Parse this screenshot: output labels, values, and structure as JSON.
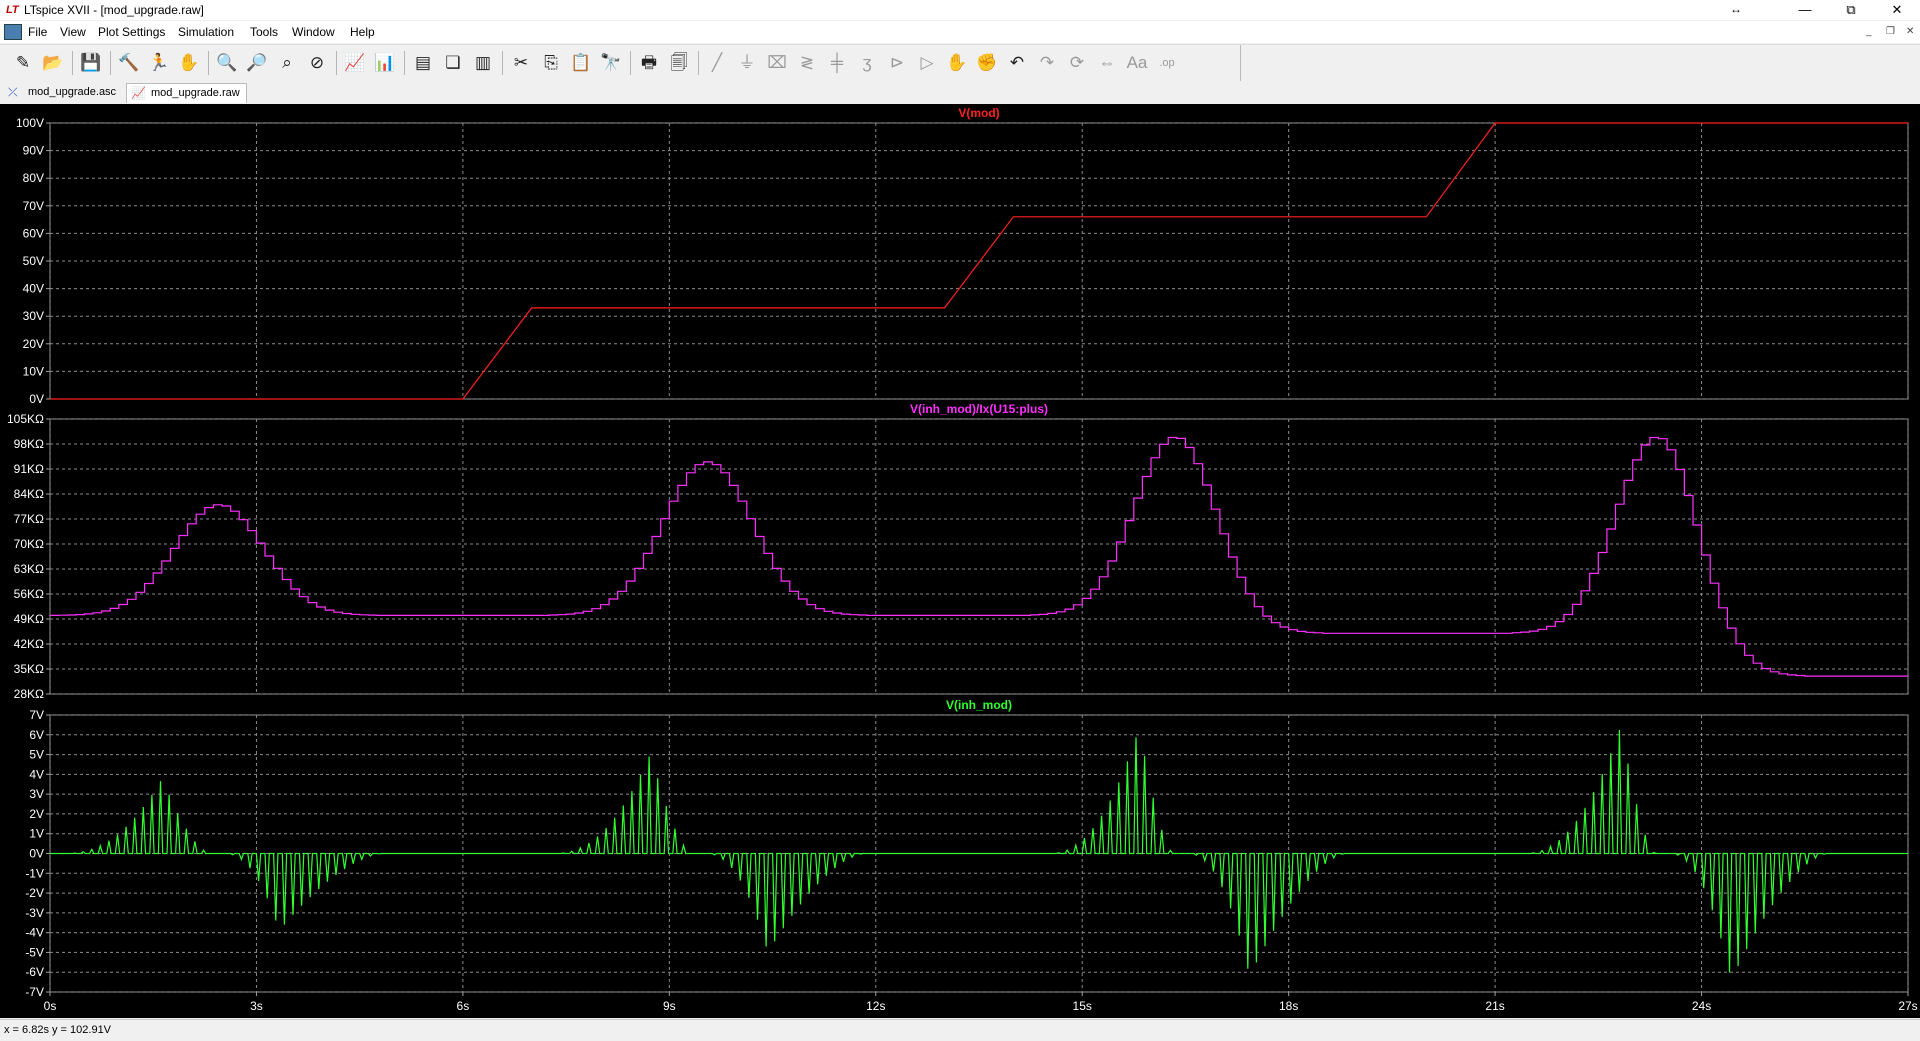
{
  "window": {
    "title": "LTspice XVII - [mod_upgrade.raw]",
    "app_icon_glyph": "LT",
    "minimize": "—",
    "restore": "⧉",
    "close": "✕",
    "resize_glyph": "↔"
  },
  "menu": [
    "File",
    "View",
    "Plot Settings",
    "Simulation",
    "Tools",
    "Window",
    "Help"
  ],
  "mdi": {
    "minimize": "_",
    "restore": "❐",
    "close": "✕"
  },
  "toolbar": [
    {
      "name": "new-schematic-icon",
      "glyph": "✎",
      "disabled": false
    },
    {
      "name": "open-icon",
      "glyph": "📂",
      "disabled": false
    },
    {
      "sep": true
    },
    {
      "name": "save-icon",
      "glyph": "💾",
      "disabled": false
    },
    {
      "sep": true
    },
    {
      "name": "control-panel-icon",
      "glyph": "🔨",
      "disabled": false
    },
    {
      "name": "run-icon",
      "glyph": "🏃",
      "disabled": false
    },
    {
      "name": "pan-hand-icon",
      "glyph": "✋",
      "disabled": false
    },
    {
      "sep": true
    },
    {
      "name": "zoom-in-icon",
      "glyph": "🔍",
      "disabled": false
    },
    {
      "name": "zoom-out-icon",
      "glyph": "🔎",
      "disabled": false
    },
    {
      "name": "zoom-fit-icon",
      "glyph": "⌕",
      "disabled": false
    },
    {
      "name": "zoom-cancel-icon",
      "glyph": "⊘",
      "disabled": false
    },
    {
      "sep": true
    },
    {
      "name": "autorange-icon",
      "glyph": "📈",
      "disabled": false
    },
    {
      "name": "fft-icon",
      "glyph": "📊",
      "disabled": false
    },
    {
      "sep": true
    },
    {
      "name": "tile-horizontal-icon",
      "glyph": "▤",
      "disabled": false
    },
    {
      "name": "cascade-icon",
      "glyph": "❏",
      "disabled": false
    },
    {
      "name": "tile-vertical-icon",
      "glyph": "▥",
      "disabled": false
    },
    {
      "sep": true
    },
    {
      "name": "cut-icon",
      "glyph": "✂",
      "disabled": false
    },
    {
      "name": "copy-icon",
      "glyph": "⎘",
      "disabled": false
    },
    {
      "name": "paste-icon",
      "glyph": "📋",
      "disabled": false
    },
    {
      "name": "find-icon",
      "glyph": "🔭",
      "disabled": false
    },
    {
      "sep": true
    },
    {
      "name": "print-icon",
      "glyph": "🖶",
      "disabled": false
    },
    {
      "name": "print-preview-icon",
      "glyph": "🗐",
      "disabled": false
    },
    {
      "sep": true
    },
    {
      "name": "wire-icon",
      "glyph": "╱",
      "disabled": true
    },
    {
      "name": "ground-icon",
      "glyph": "⏚",
      "disabled": true
    },
    {
      "name": "label-net-icon",
      "glyph": "⌧",
      "disabled": true
    },
    {
      "name": "resistor-icon",
      "glyph": "≷",
      "disabled": true
    },
    {
      "name": "capacitor-icon",
      "glyph": "╪",
      "disabled": true
    },
    {
      "name": "inductor-icon",
      "glyph": "ʒ",
      "disabled": true
    },
    {
      "name": "diode-icon",
      "glyph": "⊳",
      "disabled": true
    },
    {
      "name": "component-icon",
      "glyph": "▷",
      "disabled": true
    },
    {
      "name": "move-icon",
      "glyph": "✋",
      "disabled": true
    },
    {
      "name": "drag-icon",
      "glyph": "✊",
      "disabled": true
    },
    {
      "name": "undo-icon",
      "glyph": "↶",
      "disabled": false
    },
    {
      "name": "redo-icon",
      "glyph": "↷",
      "disabled": true
    },
    {
      "name": "rotate-icon",
      "glyph": "⟳",
      "disabled": true
    },
    {
      "name": "mirror-icon",
      "glyph": "⇔",
      "disabled": true
    },
    {
      "name": "text-icon",
      "glyph": "Aa",
      "disabled": true
    },
    {
      "name": "spice-directive-icon",
      "glyph": ".op",
      "disabled": true
    }
  ],
  "tabs": [
    {
      "label": "mod_upgrade.asc",
      "icon_glyph": "⤫",
      "icon_color": "#1f4fbf",
      "active": false
    },
    {
      "label": "mod_upgrade.raw",
      "icon_glyph": "📈",
      "icon_color": "#b03030",
      "active": true
    }
  ],
  "colors": {
    "grid": "#8c8c8c",
    "frame": "#a0a0a0",
    "axis_text": "#ffffff",
    "trace_vmod": "#ff2020",
    "trace_res": "#ff30ff",
    "trace_inh": "#30ff30"
  },
  "status": "x = 6.82s   y = 102.91V",
  "chart_data": [
    {
      "type": "line",
      "title": "V(mod)",
      "xlim": [
        0,
        27
      ],
      "ylim": [
        0,
        100
      ],
      "ytick_values": [
        0,
        10,
        20,
        30,
        40,
        50,
        60,
        70,
        80,
        90,
        100
      ],
      "ytick_labels": [
        "0V",
        "10V",
        "20V",
        "30V",
        "40V",
        "50V",
        "60V",
        "70V",
        "80V",
        "90V",
        "100V"
      ],
      "series": [
        {
          "name": "V(mod)",
          "x": [
            0,
            6,
            7,
            13,
            14,
            20,
            21,
            27
          ],
          "y": [
            0,
            0,
            33,
            33,
            66,
            66,
            100,
            100
          ]
        }
      ]
    },
    {
      "type": "line",
      "title": "V(inh_mod)/Ix(U15:plus)",
      "xlim": [
        0,
        27
      ],
      "ylim": [
        28,
        105
      ],
      "ytick_values": [
        28,
        35,
        42,
        49,
        56,
        63,
        70,
        77,
        84,
        91,
        98,
        105
      ],
      "ytick_labels": [
        "28KΩ",
        "35KΩ",
        "42KΩ",
        "49KΩ",
        "56KΩ",
        "63KΩ",
        "70KΩ",
        "77KΩ",
        "84KΩ",
        "91KΩ",
        "98KΩ",
        "105KΩ"
      ],
      "series": [
        {
          "name": "V(inh_mod)/Ix(U15:plus)",
          "baselines": [
            {
              "from": 0,
              "to": 1.3,
              "value": 50
            },
            {
              "from": 3.5,
              "to": 8.3,
              "value": 50
            },
            {
              "from": 10.6,
              "to": 14.8,
              "value": 50
            },
            {
              "from": 17.8,
              "to": 21.8,
              "value": 45
            },
            {
              "from": 24.8,
              "to": 27,
              "value": 33
            }
          ],
          "peaks": [
            {
              "center": 2.4,
              "sigma": 0.65,
              "base_left": 50,
              "base_right": 50,
              "peak": 81
            },
            {
              "center": 9.5,
              "sigma": 0.65,
              "base_left": 50,
              "base_right": 50,
              "peak": 93
            },
            {
              "center": 16.3,
              "sigma": 0.6,
              "base_left": 50,
              "base_right": 45,
              "peak": 100
            },
            {
              "center": 23.3,
              "sigma": 0.6,
              "base_left": 45,
              "base_right": 33,
              "peak": 100
            }
          ],
          "step_period": 0.125
        }
      ]
    },
    {
      "type": "line",
      "title": "V(inh_mod)",
      "xlim": [
        0,
        27
      ],
      "ylim": [
        -7,
        7
      ],
      "ytick_values": [
        -7,
        -6,
        -5,
        -4,
        -3,
        -2,
        -1,
        0,
        1,
        2,
        3,
        4,
        5,
        6,
        7
      ],
      "ytick_labels": [
        "-7V",
        "-6V",
        "-5V",
        "-4V",
        "-3V",
        "-2V",
        "-1V",
        "0V",
        "1V",
        "2V",
        "3V",
        "4V",
        "5V",
        "6V",
        "7V"
      ],
      "xtick_values": [
        0,
        3,
        6,
        9,
        12,
        15,
        18,
        21,
        24,
        27
      ],
      "xtick_labels": [
        "0s",
        "3s",
        "6s",
        "9s",
        "12s",
        "15s",
        "18s",
        "21s",
        "24s",
        "27s"
      ],
      "series": [
        {
          "name": "V(inh_mod)",
          "bursts": [
            {
              "start": 0.2,
              "end": 2.3,
              "peak_at": 1.6,
              "amp": 3.8,
              "sign": 1
            },
            {
              "start": 2.5,
              "end": 4.8,
              "peak_at": 3.3,
              "amp": 3.9,
              "sign": -1
            },
            {
              "start": 7.3,
              "end": 9.3,
              "peak_at": 8.7,
              "amp": 5.1,
              "sign": 1
            },
            {
              "start": 9.5,
              "end": 11.8,
              "peak_at": 10.4,
              "amp": 5.0,
              "sign": -1
            },
            {
              "start": 14.5,
              "end": 16.3,
              "peak_at": 15.8,
              "amp": 6.4,
              "sign": 1
            },
            {
              "start": 16.5,
              "end": 18.8,
              "peak_at": 17.4,
              "amp": 6.2,
              "sign": -1
            },
            {
              "start": 21.4,
              "end": 23.3,
              "peak_at": 22.8,
              "amp": 6.5,
              "sign": 1
            },
            {
              "start": 23.5,
              "end": 25.8,
              "peak_at": 24.4,
              "amp": 6.4,
              "sign": -1
            }
          ],
          "pulse_period": 0.125
        }
      ]
    }
  ]
}
